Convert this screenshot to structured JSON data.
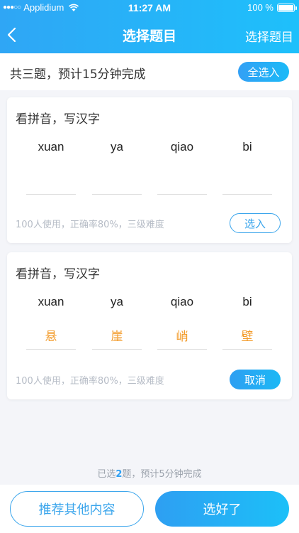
{
  "status_bar": {
    "carrier": "Applidium",
    "time": "11:27 AM",
    "battery": "100 %"
  },
  "nav": {
    "title": "选择题目",
    "right_label": "选择题目"
  },
  "summary": {
    "text": "共三题，预计15分钟完成",
    "select_all_label": "全选入"
  },
  "cards": [
    {
      "title": "看拼音，写汉字",
      "pinyin": [
        "xuan",
        "ya",
        "qiao",
        "bi"
      ],
      "answers": [
        "",
        "",
        "",
        ""
      ],
      "meta": "100人使用，正确率80%，三级难度",
      "action_label": "选入",
      "selected": false
    },
    {
      "title": "看拼音，写汉字",
      "pinyin": [
        "xuan",
        "ya",
        "qiao",
        "bi"
      ],
      "answers": [
        "悬",
        "崖",
        "峭",
        "壁"
      ],
      "meta": "100人使用，正确率80%，三级难度",
      "action_label": "取消",
      "selected": true
    }
  ],
  "footer": {
    "note_prefix": "已选",
    "selected_count": "2",
    "note_suffix": "题，预计5分钟完成",
    "recommend_label": "推荐其他内容",
    "done_label": "选好了"
  },
  "colors": {
    "accent": "#2e9ff2",
    "answer": "#f39b2a",
    "background": "#f4f5f9"
  }
}
